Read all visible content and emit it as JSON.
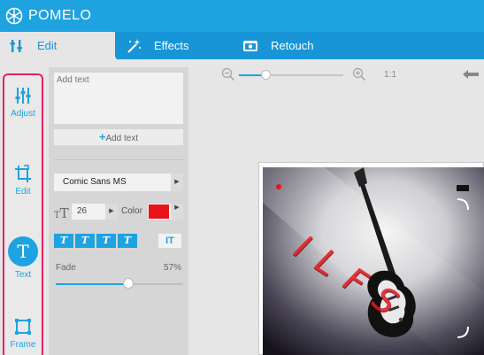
{
  "app": {
    "title": "POMELO"
  },
  "tabs": [
    {
      "label": "Edit",
      "active": true,
      "icon": "tools-icon"
    },
    {
      "label": "Effects",
      "active": false,
      "icon": "magic-wand-icon"
    },
    {
      "label": "Retouch",
      "active": false,
      "icon": "retouch-icon"
    }
  ],
  "sidebar": {
    "items": [
      {
        "label": "Adjust",
        "icon": "sliders-icon"
      },
      {
        "label": "Edit",
        "icon": "crop-icon"
      },
      {
        "label": "Text",
        "icon": "text-icon",
        "glyph": "T",
        "active": true
      },
      {
        "label": "Frame",
        "icon": "frame-icon"
      }
    ]
  },
  "text_panel": {
    "placeholder": "Add text",
    "add_button": {
      "plus": "+",
      "label": "Add text"
    },
    "font": {
      "value": "Comic Sans MS"
    },
    "size_icon": {
      "small": "T",
      "big": "T"
    },
    "size": {
      "value": "26"
    },
    "color_label": "Color",
    "color_value": "#e8141a",
    "style_buttons": [
      "T",
      "T",
      "T",
      "T"
    ],
    "vertical_button": "IT",
    "fade": {
      "label": "Fade",
      "value_text": "57%",
      "value": 0.57
    }
  },
  "zoom": {
    "ratio_label": "1:1",
    "level": 0.25
  },
  "canvas": {
    "overlay_text": "ILFS"
  },
  "colors": {
    "accent": "#1fa3e0",
    "highlight_border": "#e0216a",
    "text_overlay": "#e31c23"
  }
}
